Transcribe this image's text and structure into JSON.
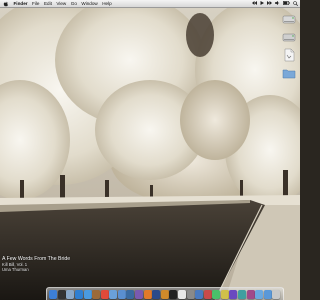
{
  "menubar": {
    "items": [
      "Finder",
      "File",
      "Edit",
      "View",
      "Go",
      "Window",
      "Help"
    ]
  },
  "now_playing": {
    "title": "A Few Words From The Bride",
    "album": "Kill Bill, Vol. 1",
    "artist": "Uma Thurman"
  },
  "desktop_icons": [
    "drive-icon",
    "drive-icon",
    "document-icon",
    "folder-icon"
  ],
  "dock": {
    "items": [
      {
        "name": "finder-icon",
        "color": "#3d7fd6"
      },
      {
        "name": "dashboard-icon",
        "color": "#333333"
      },
      {
        "name": "mail-icon",
        "color": "#8aa8c8"
      },
      {
        "name": "safari-icon",
        "color": "#2f7fd1"
      },
      {
        "name": "ichat-icon",
        "color": "#4a9ae0"
      },
      {
        "name": "address-book-icon",
        "color": "#9b6a3a"
      },
      {
        "name": "ical-icon",
        "color": "#e04a3a"
      },
      {
        "name": "preview-icon",
        "color": "#6aa0d8"
      },
      {
        "name": "itunes-icon",
        "color": "#5a8fd0"
      },
      {
        "name": "iphoto-icon",
        "color": "#3a6aa0"
      },
      {
        "name": "imovie-icon",
        "color": "#7a5ab0"
      },
      {
        "name": "firefox-icon",
        "color": "#e07a2a"
      },
      {
        "name": "photoshop-icon",
        "color": "#2a4a8a"
      },
      {
        "name": "illustrator-icon",
        "color": "#d08a2a"
      },
      {
        "name": "terminal-icon",
        "color": "#222222"
      },
      {
        "name": "textedit-icon",
        "color": "#e8e8e8"
      },
      {
        "name": "system-preferences-icon",
        "color": "#8a8a8a"
      },
      {
        "name": "quicktime-icon",
        "color": "#4a7ac0"
      },
      {
        "name": "app-icon",
        "color": "#c84a4a"
      },
      {
        "name": "app-icon",
        "color": "#4ac06a"
      },
      {
        "name": "app-icon",
        "color": "#d0c04a"
      },
      {
        "name": "app-icon",
        "color": "#6a4ac0"
      },
      {
        "name": "app-icon",
        "color": "#40a0a0"
      },
      {
        "name": "app-icon",
        "color": "#a04a8a"
      },
      {
        "name": "documents-folder-icon",
        "color": "#6aa8e0"
      },
      {
        "name": "downloads-folder-icon",
        "color": "#5a98d8"
      },
      {
        "name": "trash-icon",
        "color": "#c8c8c8"
      }
    ]
  }
}
